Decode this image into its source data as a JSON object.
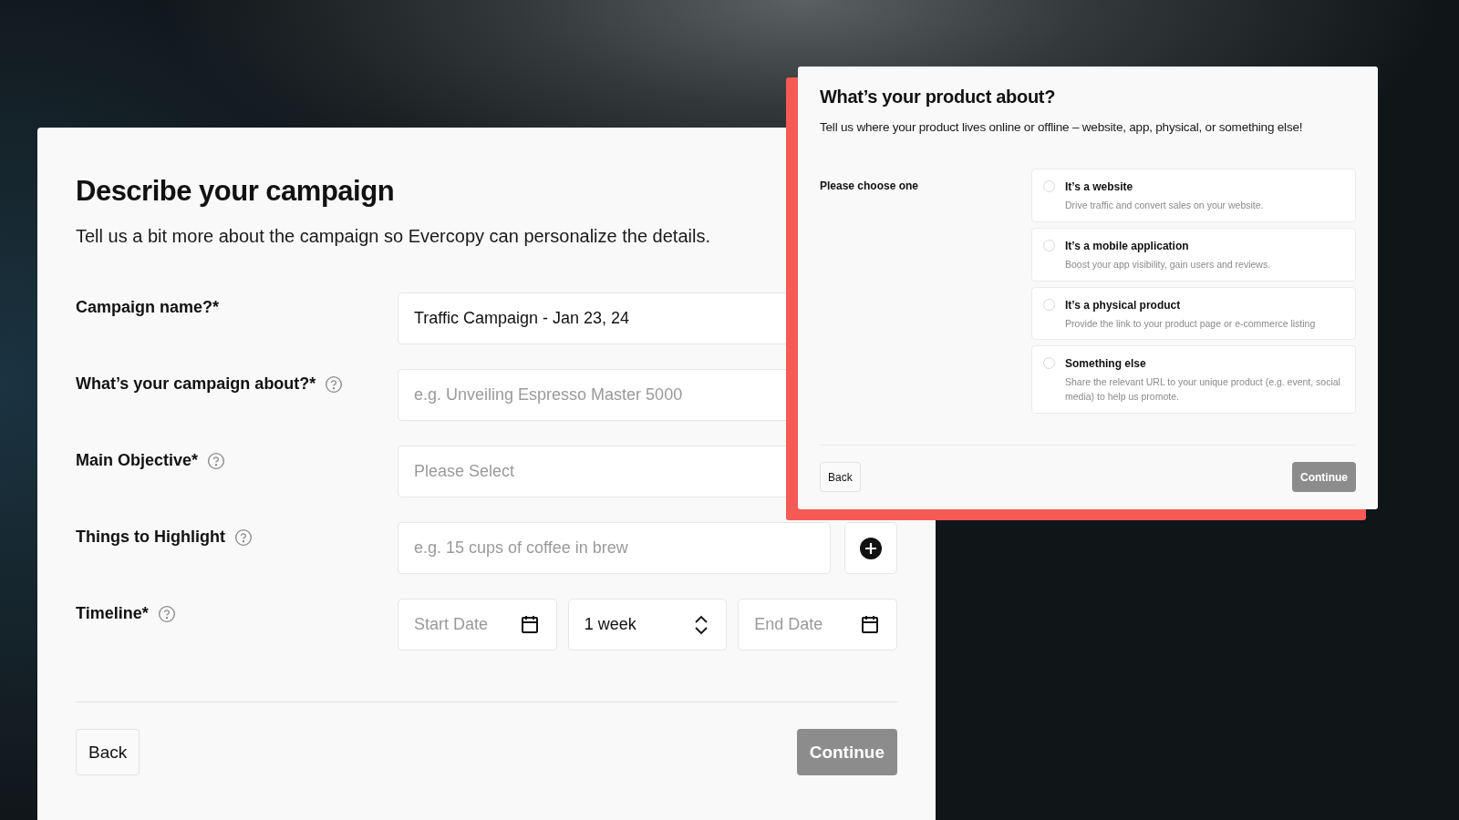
{
  "campaign_form": {
    "title": "Describe your campaign",
    "subtitle": "Tell us a bit more about the campaign so Evercopy can personalize the details.",
    "fields": [
      {
        "kind": "text",
        "label": "Campaign name?*",
        "help": false,
        "value": "Traffic Campaign - Jan 23, 24"
      },
      {
        "kind": "text",
        "label": "What’s your campaign about?*",
        "help": true,
        "placeholder": "e.g. Unveiling Espresso Master 5000"
      },
      {
        "kind": "select",
        "label": "Main Objective*",
        "help": true,
        "placeholder": "Please Select"
      },
      {
        "kind": "add",
        "label": "Things to Highlight",
        "help": true,
        "placeholder": "e.g. 15 cups of coffee in brew"
      },
      {
        "kind": "timeline",
        "label": "Timeline*",
        "help": true,
        "start_placeholder": "Start Date",
        "duration": "1 week",
        "end_placeholder": "End Date"
      }
    ],
    "back_button": {
      "label": "Back"
    },
    "continue_button": {
      "label": "Continue",
      "disabled": true
    }
  },
  "product_dialog": {
    "title": "What’s your product about?",
    "subtitle": "Tell us where your product lives online or offline – website, app, physical, or something else!",
    "prompt": "Please choose one",
    "options": [
      {
        "title": "It’s a website",
        "description": "Drive traffic and convert sales on your website.",
        "selected": false
      },
      {
        "title": "It’s a mobile application",
        "description": "Boost your app visibility, gain users and reviews.",
        "selected": false
      },
      {
        "title": "It’s a physical product",
        "description": "Provide the link to your product page or e-commerce listing",
        "selected": false
      },
      {
        "title": "Something else",
        "description": "Share the relevant URL to your unique product (e.g. event, social media) to help us promote.",
        "selected": false
      }
    ],
    "back_button": {
      "label": "Back"
    },
    "continue_button": {
      "label": "Continue",
      "disabled": true
    }
  }
}
